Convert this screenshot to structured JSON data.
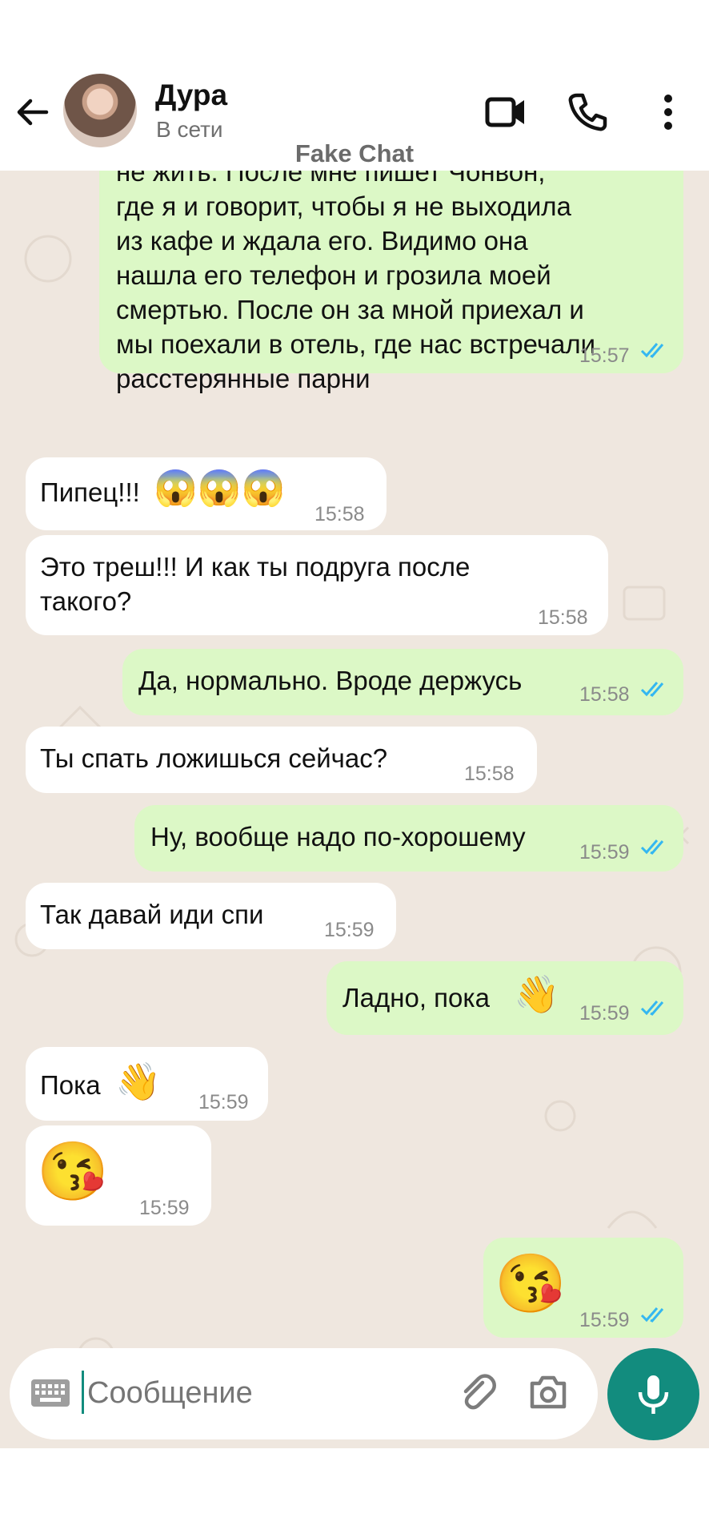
{
  "header": {
    "contact_name": "Дура",
    "contact_status": "В сети",
    "watermark": "Fake Chat"
  },
  "messages": [
    {
      "dir": "out",
      "text_lines": [
        "не жить. После мне пишет Чонвон,",
        "где я и говорит, чтобы я не выходила",
        "из кафе и ждала его. Видимо она",
        "нашла его телефон и грозила моей",
        "смертью. После он за мной приехал и",
        "мы поехали в отель, где нас встречали",
        "расстерянные парни"
      ],
      "time": "15:57"
    },
    {
      "dir": "in",
      "text": "Пипец!!!",
      "emoji": "😱😱😱",
      "time": "15:58"
    },
    {
      "dir": "in",
      "text_lines": [
        "Это треш!!! И как ты подруга после",
        "такого?"
      ],
      "time": "15:58"
    },
    {
      "dir": "out",
      "text": "Да, нормально. Вроде держусь",
      "time": "15:58"
    },
    {
      "dir": "in",
      "text": "Ты спать ложишься сейчас?",
      "time": "15:58"
    },
    {
      "dir": "out",
      "text": "Ну, вообще надо по-хорошему",
      "time": "15:59"
    },
    {
      "dir": "in",
      "text": "Так давай иди спи",
      "time": "15:59"
    },
    {
      "dir": "out",
      "text": "Ладно, пока",
      "emoji": "👋",
      "time": "15:59"
    },
    {
      "dir": "in",
      "text": "Пока",
      "emoji": "👋",
      "time": "15:59"
    },
    {
      "dir": "in",
      "emoji": "😘",
      "time": "15:59"
    },
    {
      "dir": "out",
      "emoji": "😘",
      "time": "15:59"
    }
  ],
  "composer": {
    "placeholder": "Сообщение"
  },
  "icons": {
    "back": "arrow-left-icon",
    "video": "video-call-icon",
    "call": "phone-icon",
    "menu": "more-vert-icon",
    "keyboard": "keyboard-icon",
    "attach": "paperclip-icon",
    "camera": "camera-icon",
    "mic": "microphone-icon"
  },
  "colors": {
    "incoming_bubble": "#ffffff",
    "outgoing_bubble": "#dcf8c6",
    "chat_background": "#efe7df",
    "read_ticks": "#34b7f1",
    "accent": "#128c7e"
  }
}
